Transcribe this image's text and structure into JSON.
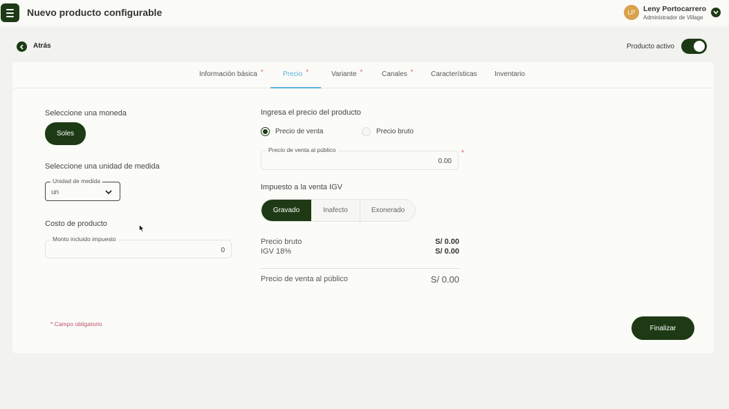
{
  "header": {
    "title": "Nuevo producto configurable",
    "user": {
      "initials": "LP",
      "name": "Leny Portocarrero",
      "role": "Administrador de Village"
    }
  },
  "nav": {
    "back_label": "Atrás",
    "active_label": "Producto activo",
    "active": true
  },
  "tabs": [
    {
      "label": "Información básica",
      "required": "*"
    },
    {
      "label": "Precio",
      "required": "*",
      "active": true
    },
    {
      "label": "Variante",
      "required": "*"
    },
    {
      "label": "Canales",
      "required": "*"
    },
    {
      "label": "Características",
      "required": ""
    },
    {
      "label": "Inventario",
      "required": ""
    }
  ],
  "left": {
    "currency_heading": "Seleccione una moneda",
    "currency_button": "Soles",
    "unit_heading": "Seleccione una unidad de medida",
    "unit_label": "Unidad de medida",
    "unit_value": "un",
    "cost_heading": "Costo de producto",
    "cost_label": "Monto incluido impuesto",
    "cost_value": "0"
  },
  "right": {
    "price_heading": "Ingresa el precio del producto",
    "radio_sale": "Precio de venta",
    "radio_gross": "Precio bruto",
    "selected_radio": "Precio de venta",
    "price_field_label": "Precio de venta al público",
    "price_field_value": "0.00",
    "price_required": "*",
    "tax_heading": "Impuesto a la venta IGV",
    "tax_options": [
      "Gravado",
      "Inafecto",
      "Exonerado"
    ],
    "tax_selected": "Gravado",
    "summary": [
      {
        "label": "Precio bruto",
        "amount": "S/ 0.00"
      },
      {
        "label": "IGV 18%",
        "amount": "S/ 0.00"
      }
    ],
    "total_label": "Precio de venta al público",
    "total_amount": "S/ 0.00"
  },
  "footer": {
    "required_note": "* Campo obligatorio",
    "finish_button": "Finalizar"
  },
  "colors": {
    "primary": "#1d3a15",
    "tab_active": "#5ab0d9",
    "required": "#d9534f",
    "avatar": "#d9a24a"
  }
}
